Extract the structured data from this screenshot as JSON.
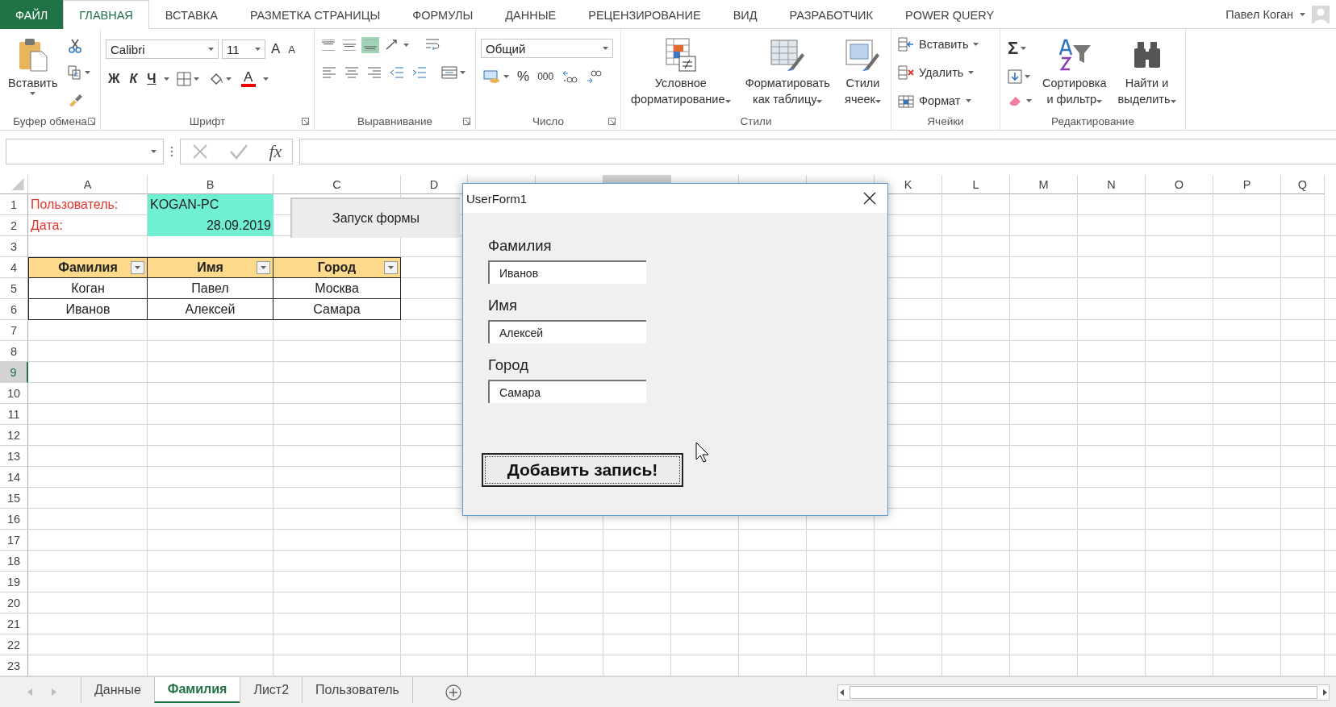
{
  "ribbon_tabs": [
    {
      "label": "ФАЙЛ",
      "kind": "file",
      "selected": false
    },
    {
      "label": "ГЛАВНАЯ",
      "kind": "tab",
      "selected": true
    },
    {
      "label": "ВСТАВКА",
      "kind": "tab",
      "selected": false
    },
    {
      "label": "РАЗМЕТКА СТРАНИЦЫ",
      "kind": "tab",
      "selected": false
    },
    {
      "label": "ФОРМУЛЫ",
      "kind": "tab",
      "selected": false
    },
    {
      "label": "ДАННЫЕ",
      "kind": "tab",
      "selected": false
    },
    {
      "label": "РЕЦЕНЗИРОВАНИЕ",
      "kind": "tab",
      "selected": false
    },
    {
      "label": "ВИД",
      "kind": "tab",
      "selected": false
    },
    {
      "label": "РАЗРАБОТЧИК",
      "kind": "tab",
      "selected": false
    },
    {
      "label": "POWER QUERY",
      "kind": "tab",
      "selected": false
    }
  ],
  "account": {
    "user": "Павел Коган"
  },
  "clipboard": {
    "title": "Буфер обмена",
    "paste": "Вставить"
  },
  "font": {
    "title": "Шрифт",
    "name": "Calibri",
    "size": "11",
    "grow": "A",
    "shrink": "A",
    "bold": "Ж",
    "italic": "К",
    "underline": "Ч",
    "color_glyph": "A"
  },
  "alignment": {
    "title": "Выравнивание",
    "vertical": [
      {
        "selected": false
      },
      {
        "selected": false
      },
      {
        "selected": true
      }
    ]
  },
  "number": {
    "title": "Число",
    "format": "Общий",
    "percent": "%",
    "thousands": "000"
  },
  "styles": {
    "title": "Стили",
    "buttons": [
      {
        "lines": [
          "Условное",
          "форматирование"
        ],
        "kind": "conditional"
      },
      {
        "lines": [
          "Форматировать",
          "как таблицу"
        ],
        "kind": "table"
      },
      {
        "lines": [
          "Стили",
          "ячеек"
        ],
        "kind": "cellstyles"
      }
    ]
  },
  "cells_group": {
    "title": "Ячейки",
    "buttons": [
      {
        "label": "Вставить",
        "kind": "insert"
      },
      {
        "label": "Удалить",
        "kind": "delete"
      },
      {
        "label": "Формат",
        "kind": "format"
      }
    ]
  },
  "editing": {
    "title": "Редактирование",
    "sum": "Σ",
    "buttons": [
      {
        "lines": [
          "Сортировка",
          "и фильтр"
        ],
        "kind": "sort"
      },
      {
        "lines": [
          "Найти и",
          "выделить"
        ],
        "kind": "find"
      }
    ]
  },
  "formula_bar": {
    "fx": "fx"
  },
  "sheet": {
    "columns": [
      {
        "label": "A",
        "selected": false
      },
      {
        "label": "B",
        "selected": false
      },
      {
        "label": "C",
        "selected": false
      },
      {
        "label": "D",
        "selected": false
      },
      {
        "selected": false
      },
      {
        "selected": false
      },
      {
        "selected": true
      },
      {
        "selected": false
      },
      {
        "selected": false
      },
      {
        "selected": false
      },
      {
        "label": "K",
        "selected": false
      },
      {
        "label": "L",
        "selected": false
      },
      {
        "label": "M",
        "selected": false
      },
      {
        "label": "N",
        "selected": false
      },
      {
        "label": "O",
        "selected": false
      },
      {
        "label": "P",
        "selected": false
      },
      {
        "label": "Q",
        "selected": false
      }
    ],
    "rows": [
      {
        "label": "1",
        "selected": false,
        "cells": [
          {
            "text": "Пользователь:",
            "kind": "label"
          },
          {
            "text": "KOGAN-PC",
            "kind": "highlight"
          }
        ]
      },
      {
        "label": "2",
        "selected": false,
        "cells": [
          {
            "text": "Дата:",
            "kind": "label"
          },
          {
            "text": "28.09.2019",
            "kind": "highlight-date"
          }
        ]
      },
      {
        "label": "3",
        "selected": false,
        "cells": []
      },
      {
        "label": "4",
        "selected": false,
        "cells": [
          {
            "text": "Фамилия",
            "kind": "header"
          },
          {
            "text": "Имя",
            "kind": "header"
          },
          {
            "text": "Город",
            "kind": "header"
          }
        ]
      },
      {
        "label": "5",
        "selected": false,
        "cells": [
          {
            "text": "Коган",
            "kind": "data"
          },
          {
            "text": "Павел",
            "kind": "data"
          },
          {
            "text": "Москва",
            "kind": "data"
          }
        ]
      },
      {
        "label": "6",
        "selected": false,
        "cells": [
          {
            "text": "Иванов",
            "kind": "data"
          },
          {
            "text": "Алексей",
            "kind": "data"
          },
          {
            "text": "Самара",
            "kind": "data"
          }
        ]
      },
      {
        "label": "7",
        "selected": false,
        "cells": []
      },
      {
        "label": "8",
        "selected": false,
        "cells": []
      },
      {
        "label": "9",
        "selected": true,
        "cells": []
      },
      {
        "label": "10",
        "selected": false,
        "cells": []
      },
      {
        "label": "11",
        "selected": false,
        "cells": []
      },
      {
        "label": "12",
        "selected": false,
        "cells": []
      },
      {
        "label": "13",
        "selected": false,
        "cells": []
      },
      {
        "label": "14",
        "selected": false,
        "cells": []
      },
      {
        "label": "15",
        "selected": false,
        "cells": []
      },
      {
        "label": "16",
        "selected": false,
        "cells": []
      },
      {
        "label": "17",
        "selected": false,
        "cells": []
      },
      {
        "label": "18",
        "selected": false,
        "cells": []
      },
      {
        "label": "19",
        "selected": false,
        "cells": []
      },
      {
        "label": "20",
        "selected": false,
        "cells": []
      },
      {
        "label": "21",
        "selected": false,
        "cells": []
      },
      {
        "label": "22",
        "selected": false,
        "cells": []
      },
      {
        "label": "23",
        "selected": false,
        "cells": []
      }
    ],
    "macro_button": "Запуск формы"
  },
  "dialog": {
    "title": "UserForm1",
    "fields": [
      {
        "label": "Фамилия",
        "value": "Иванов"
      },
      {
        "label": "Имя",
        "value": "Алексей"
      },
      {
        "label": "Город",
        "value": "Самара"
      }
    ],
    "button": "Добавить запись!"
  },
  "sheet_tabs": [
    {
      "label": "Данные",
      "selected": false
    },
    {
      "label": "Фамилия",
      "selected": true
    },
    {
      "label": "Лист2",
      "selected": false
    },
    {
      "label": "Пользователь",
      "selected": false
    }
  ]
}
